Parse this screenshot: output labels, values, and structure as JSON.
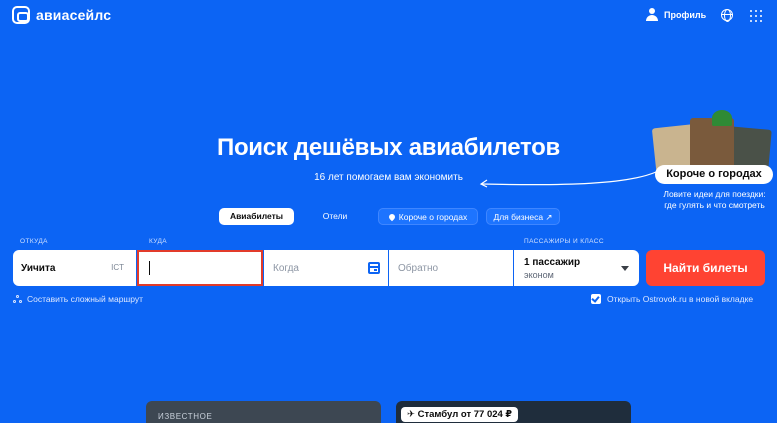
{
  "header": {
    "logo_text": "авиасейлс",
    "profile_label": "Профиль",
    "icons": [
      "user-icon",
      "globe-icon",
      "apps-grid-icon"
    ]
  },
  "hero": {
    "title": "Поиск дешёвых авиабилетов",
    "subtitle": "16 лет помогаем вам экономить"
  },
  "promo": {
    "badge": "Короче о городах",
    "description_line1": "Ловите идеи для поездки:",
    "description_line2": "где гулять и что смотреть"
  },
  "tabs": [
    {
      "label": "Авиабилеты",
      "active": true
    },
    {
      "label": "Отели",
      "active": false
    },
    {
      "label": "Короче о городах",
      "active": false,
      "icon": "pin-icon"
    },
    {
      "label": "Для бизнеса ↗",
      "active": false
    }
  ],
  "form": {
    "labels": {
      "from": "ОТКУДА",
      "to": "КУДА",
      "passengers": "ПАССАЖИРЫ И КЛАСС"
    },
    "from": {
      "city": "Уичита",
      "code": "ICT"
    },
    "to": {
      "value": ""
    },
    "when": {
      "placeholder": "Когда"
    },
    "back": {
      "placeholder": "Обратно"
    },
    "passengers": {
      "count": "1 пассажир",
      "class": "эконом"
    },
    "search_button": "Найти билеты"
  },
  "options": {
    "complex_route": "Составить сложный маршрут",
    "ostrovok_label": "Открыть Ostrovok.ru в новой вкладке",
    "ostrovok_checked": true
  },
  "cards": {
    "card1_label": "ИЗВЕСТНОЕ",
    "card2_badge": "✈ Стамбул от 77 024 ₽"
  },
  "colors": {
    "background": "#0c64f4",
    "accent_button": "#ff4332",
    "active_field_border": "#e23b2a"
  }
}
